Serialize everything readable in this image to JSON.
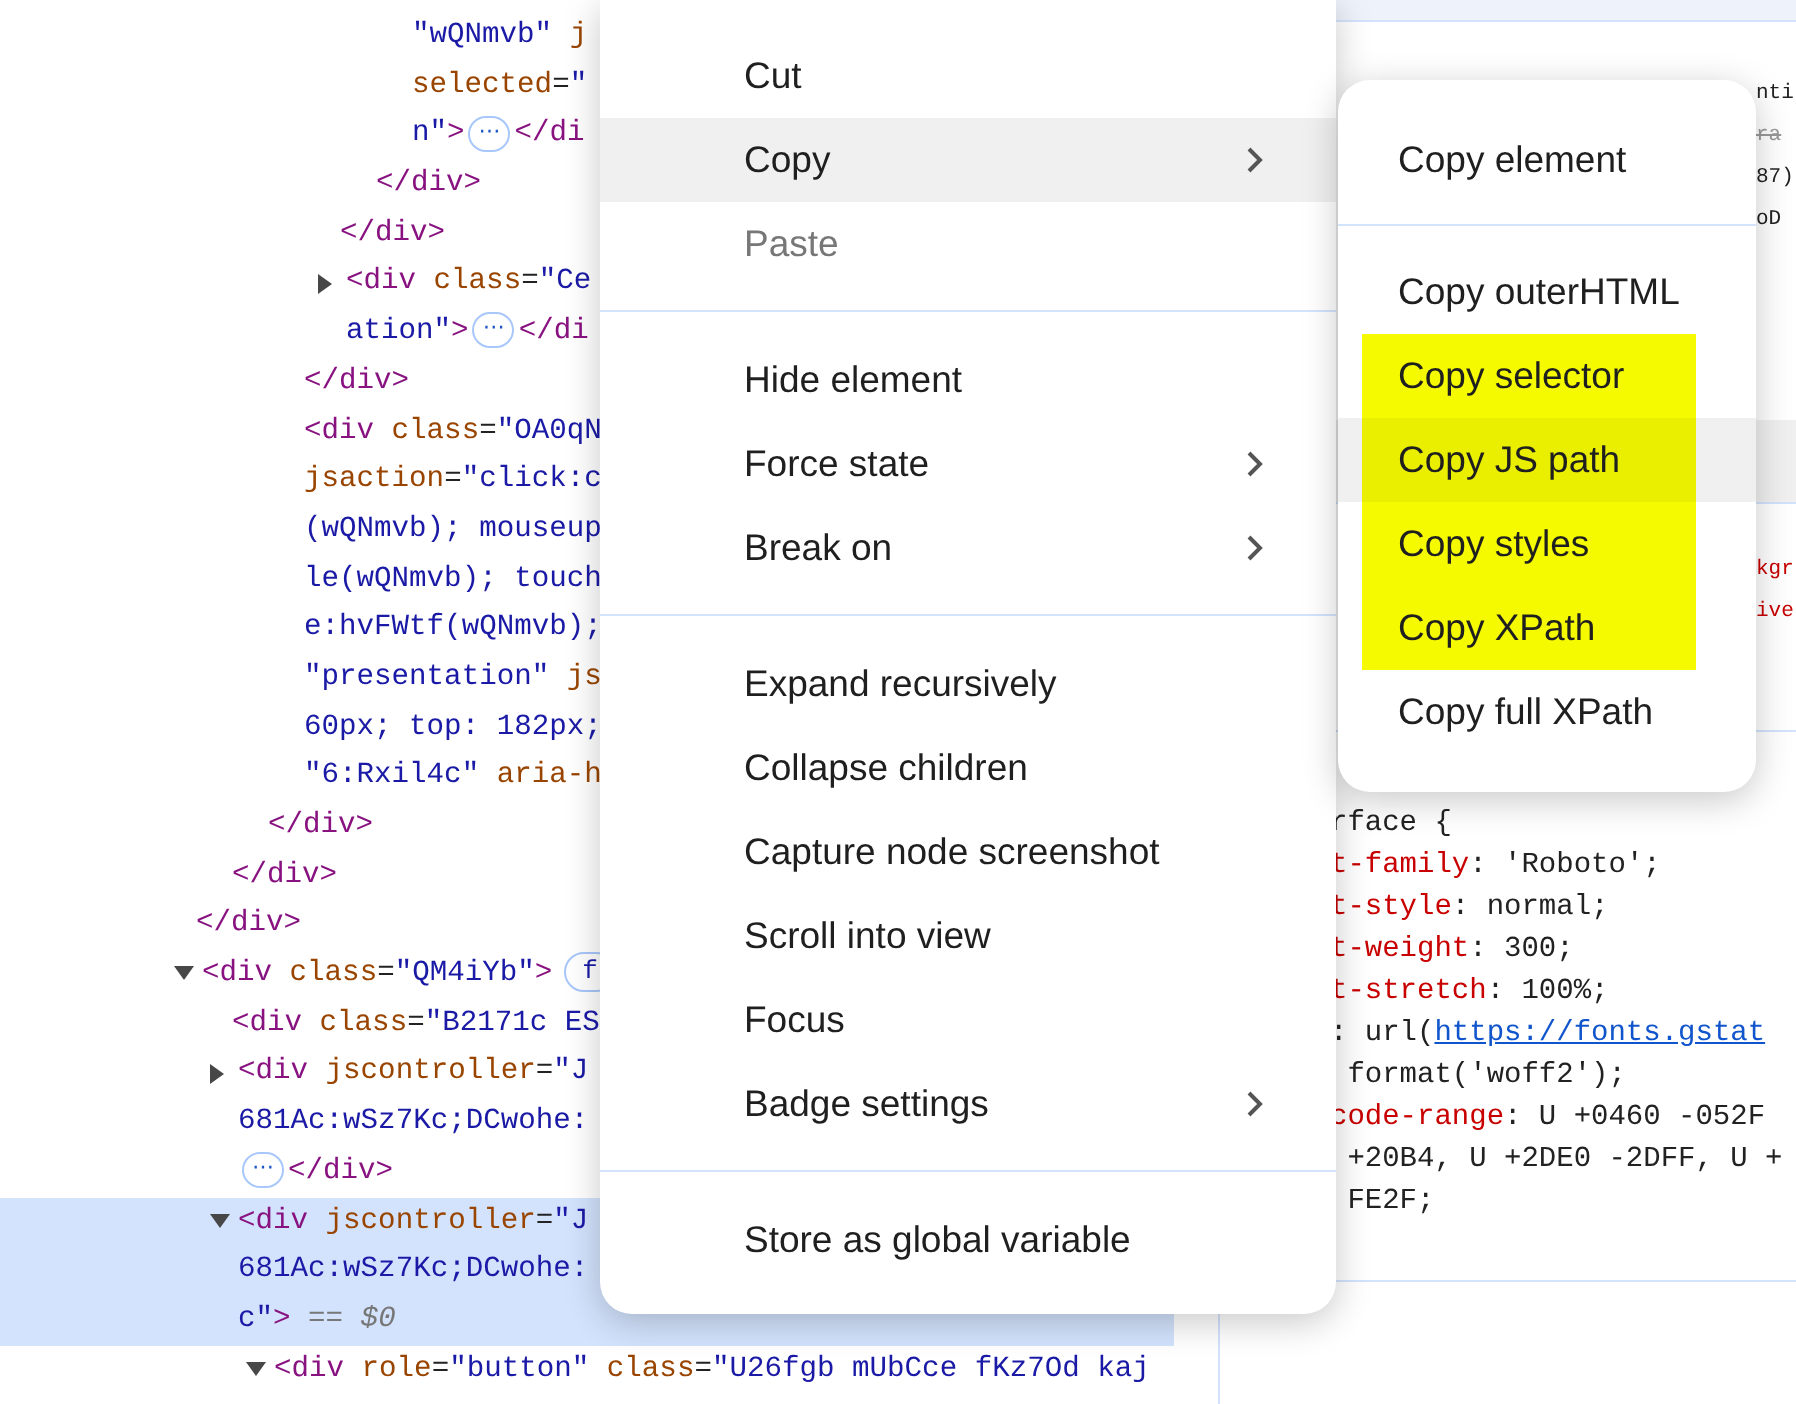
{
  "elements_tree": [
    {
      "closing": [
        {
          "kind": "tag",
          "text": "</div>"
        }
      ],
      "children": [
        {
          "closing": [
            {
              "kind": "tag",
              "text": "</div>"
            }
          ],
          "children": [
            {
              "closing": [
                {
                  "kind": "tag",
                  "text": "</div>"
                }
              ],
              "children": [
                {
                  "closing": [
                    {
                      "kind": "tag",
                      "text": "</div>"
                    }
                  ],
                  "children": [
                    {
                      "closing": [
                        {
                          "kind": "tag",
                          "text": "</div>"
                        }
                      ],
                      "children": [
                        {
                          "closing": [
                            {
                              "kind": "tag",
                              "text": "</div>"
                            }
                          ],
                          "children": [
                            {
                              "selected": false,
                              "lines": [
                                [
                                  {
                                    "kind": "value",
                                    "text": "\"wQNmvb\""
                                  },
                                  {
                                    "kind": "attr",
                                    "text": " j"
                                  }
                                ],
                                [
                                  {
                                    "kind": "attr",
                                    "text": "selected"
                                  },
                                  {
                                    "kind": "plain",
                                    "text": "="
                                  },
                                  {
                                    "kind": "value",
                                    "text": "\""
                                  }
                                ],
                                [
                                  {
                                    "kind": "value",
                                    "text": "n\""
                                  },
                                  {
                                    "kind": "tag",
                                    "text": ">"
                                  },
                                  {
                                    "kind": "ellipsis",
                                    "text": "⋯"
                                  },
                                  {
                                    "kind": "tag",
                                    "text": "</di"
                                  }
                                ]
                              ]
                            }
                          ]
                        }
                      ]
                    },
                    {
                      "selected": false,
                      "expanded": false,
                      "lines": [
                        [
                          {
                            "kind": "tag",
                            "text": "<div"
                          },
                          {
                            "kind": "attr",
                            "text": " class"
                          },
                          {
                            "kind": "plain",
                            "text": "="
                          },
                          {
                            "kind": "value",
                            "text": "\"Ce"
                          }
                        ],
                        [
                          {
                            "kind": "value",
                            "text": "ation\""
                          },
                          {
                            "kind": "tag",
                            "text": ">"
                          },
                          {
                            "kind": "ellipsis",
                            "text": "⋯"
                          },
                          {
                            "kind": "tag",
                            "text": "</di"
                          }
                        ]
                      ]
                    }
                  ]
                },
                {
                  "selected": false,
                  "lines": [
                    [
                      {
                        "kind": "tag",
                        "text": "<div"
                      },
                      {
                        "kind": "attr",
                        "text": " class"
                      },
                      {
                        "kind": "plain",
                        "text": "="
                      },
                      {
                        "kind": "value",
                        "text": "\"OA0qN"
                      }
                    ],
                    [
                      {
                        "kind": "attr",
                        "text": "jsaction"
                      },
                      {
                        "kind": "plain",
                        "text": "="
                      },
                      {
                        "kind": "value",
                        "text": "\"click:c"
                      }
                    ],
                    [
                      {
                        "kind": "value",
                        "text": "(wQNmvb); mouseup"
                      }
                    ],
                    [
                      {
                        "kind": "value",
                        "text": "le(wQNmvb); touch"
                      }
                    ],
                    [
                      {
                        "kind": "value",
                        "text": "e:hvFWtf(wQNmvb);"
                      }
                    ],
                    [
                      {
                        "kind": "value",
                        "text": "\"presentation\""
                      },
                      {
                        "kind": "attr",
                        "text": " js"
                      }
                    ],
                    [
                      {
                        "kind": "value",
                        "text": "60px; top: 182px;"
                      }
                    ],
                    [
                      {
                        "kind": "value",
                        "text": "\"6:Rxil4c\""
                      },
                      {
                        "kind": "attr",
                        "text": " aria-h"
                      }
                    ]
                  ]
                }
              ]
            }
          ]
        }
      ]
    },
    {
      "selected": false,
      "expanded": true,
      "lines": [
        [
          {
            "kind": "tag",
            "text": "<div"
          },
          {
            "kind": "attr",
            "text": " class"
          },
          {
            "kind": "plain",
            "text": "="
          },
          {
            "kind": "value",
            "text": "\"QM4iYb\""
          },
          {
            "kind": "tag",
            "text": ">"
          },
          {
            "kind": "badge",
            "text": "f"
          }
        ]
      ],
      "children": [
        {
          "selected": false,
          "lines": [
            [
              {
                "kind": "tag",
                "text": "<div"
              },
              {
                "kind": "attr",
                "text": " class"
              },
              {
                "kind": "plain",
                "text": "="
              },
              {
                "kind": "value",
                "text": "\"B2171c ES"
              }
            ]
          ]
        },
        {
          "selected": false,
          "expanded": false,
          "lines": [
            [
              {
                "kind": "tag",
                "text": "<div"
              },
              {
                "kind": "attr",
                "text": " jscontroller"
              },
              {
                "kind": "plain",
                "text": "="
              },
              {
                "kind": "value",
                "text": "\"J"
              }
            ],
            [
              {
                "kind": "value",
                "text": "681Ac:wSz7Kc;DCwohe:"
              }
            ],
            [
              {
                "kind": "ellipsis",
                "text": "⋯"
              },
              {
                "kind": "tag",
                "text": "</div>"
              }
            ]
          ]
        },
        {
          "selected": true,
          "expanded": true,
          "lines": [
            [
              {
                "kind": "tag",
                "text": "<div"
              },
              {
                "kind": "attr",
                "text": " jscontroller"
              },
              {
                "kind": "plain",
                "text": "="
              },
              {
                "kind": "value",
                "text": "\"J"
              }
            ],
            [
              {
                "kind": "value",
                "text": "681Ac:wSz7Kc;DCwohe:"
              }
            ],
            [
              {
                "kind": "value",
                "text": "c\""
              },
              {
                "kind": "tag",
                "text": ">"
              },
              {
                "kind": "dollar",
                "text": " == $0"
              }
            ]
          ],
          "children": [
            {
              "selected": false,
              "expanded": true,
              "lines": [
                [
                  {
                    "kind": "tag",
                    "text": "<div"
                  },
                  {
                    "kind": "attr",
                    "text": " role"
                  },
                  {
                    "kind": "plain",
                    "text": "="
                  },
                  {
                    "kind": "value",
                    "text": "\"button\""
                  },
                  {
                    "kind": "attr",
                    "text": " class"
                  },
                  {
                    "kind": "plain",
                    "text": "="
                  },
                  {
                    "kind": "value",
                    "text": "\"U26fgb mUbCce fKz7Od kaj"
                  }
                ]
              ]
            }
          ]
        }
      ]
    }
  ],
  "styles_pane": {
    "sections": [
      {
        "kind": "fragments",
        "lines": [
          [
            {
              "kind": "plain",
              "text": "nti"
            }
          ],
          [
            {
              "kind": "struck",
              "text": "ra"
            }
          ],
          [
            {
              "kind": "plain",
              "text": "87)"
            }
          ],
          [
            {
              "kind": "plain",
              "text": "oD"
            }
          ]
        ]
      },
      {
        "kind": "header"
      },
      {
        "kind": "fragments",
        "lines": [
          [
            {
              "kind": "prop",
              "text": "kgr"
            }
          ],
          [
            {
              "kind": "prop",
              "text": "ive"
            }
          ]
        ]
      },
      {
        "kind": "rule",
        "lines": [
          [
            {
              "kind": "plain",
              "text": "rface {"
            }
          ],
          [
            {
              "kind": "prop",
              "text": "t-family"
            },
            {
              "kind": "plain",
              "text": ": 'Roboto';"
            }
          ],
          [
            {
              "kind": "prop",
              "text": "t-style"
            },
            {
              "kind": "plain",
              "text": ": normal;"
            }
          ],
          [
            {
              "kind": "prop",
              "text": "t-weight"
            },
            {
              "kind": "plain",
              "text": ": 300;"
            }
          ],
          [
            {
              "kind": "prop",
              "text": "t-stretch"
            },
            {
              "kind": "plain",
              "text": ": 100%;"
            }
          ],
          [
            {
              "kind": "plain",
              "text": ": url("
            },
            {
              "kind": "link",
              "text": "https://fonts.gstat"
            }
          ],
          [
            {
              "kind": "plain",
              "text": " format('woff2');"
            }
          ],
          [
            {
              "kind": "prop",
              "text": "code-range"
            },
            {
              "kind": "plain",
              "text": ": U +0460 -052F"
            }
          ],
          [
            {
              "kind": "plain",
              "text": " +20B4, U +2DE0 -2DFF, U +"
            }
          ],
          [
            {
              "kind": "plain",
              "text": " FE2F;"
            }
          ]
        ]
      }
    ]
  },
  "context_menu": {
    "items": [
      {
        "kind": "item",
        "label": "Cut",
        "hovered": false,
        "disabled": false,
        "submenu": false
      },
      {
        "kind": "item",
        "label": "Copy",
        "hovered": true,
        "disabled": false,
        "submenu": true
      },
      {
        "kind": "item",
        "label": "Paste",
        "hovered": false,
        "disabled": true,
        "submenu": false
      },
      {
        "kind": "separator"
      },
      {
        "kind": "item",
        "label": "Hide element",
        "hovered": false,
        "disabled": false,
        "submenu": false
      },
      {
        "kind": "item",
        "label": "Force state",
        "hovered": false,
        "disabled": false,
        "submenu": true
      },
      {
        "kind": "item",
        "label": "Break on",
        "hovered": false,
        "disabled": false,
        "submenu": true
      },
      {
        "kind": "separator"
      },
      {
        "kind": "item",
        "label": "Expand recursively",
        "hovered": false,
        "disabled": false,
        "submenu": false
      },
      {
        "kind": "item",
        "label": "Collapse children",
        "hovered": false,
        "disabled": false,
        "submenu": false
      },
      {
        "kind": "item",
        "label": "Capture node screenshot",
        "hovered": false,
        "disabled": false,
        "submenu": false
      },
      {
        "kind": "item",
        "label": "Scroll into view",
        "hovered": false,
        "disabled": false,
        "submenu": false
      },
      {
        "kind": "item",
        "label": "Focus",
        "hovered": false,
        "disabled": false,
        "submenu": false
      },
      {
        "kind": "item",
        "label": "Badge settings",
        "hovered": false,
        "disabled": false,
        "submenu": true
      },
      {
        "kind": "separator"
      },
      {
        "kind": "item",
        "label": "Store as global variable",
        "hovered": false,
        "disabled": false,
        "submenu": false
      }
    ]
  },
  "copy_submenu": {
    "items": [
      {
        "kind": "item",
        "label": "Copy element",
        "hovered": false,
        "highlighted": false
      },
      {
        "kind": "separator"
      },
      {
        "kind": "item",
        "label": "Copy outerHTML",
        "hovered": false,
        "highlighted": false
      },
      {
        "kind": "item",
        "label": "Copy selector",
        "hovered": false,
        "highlighted": true
      },
      {
        "kind": "item",
        "label": "Copy JS path",
        "hovered": true,
        "highlighted": true
      },
      {
        "kind": "item",
        "label": "Copy styles",
        "hovered": false,
        "highlighted": true
      },
      {
        "kind": "item",
        "label": "Copy XPath",
        "hovered": false,
        "highlighted": true
      },
      {
        "kind": "item",
        "label": "Copy full XPath",
        "hovered": false,
        "highlighted": false
      }
    ]
  }
}
